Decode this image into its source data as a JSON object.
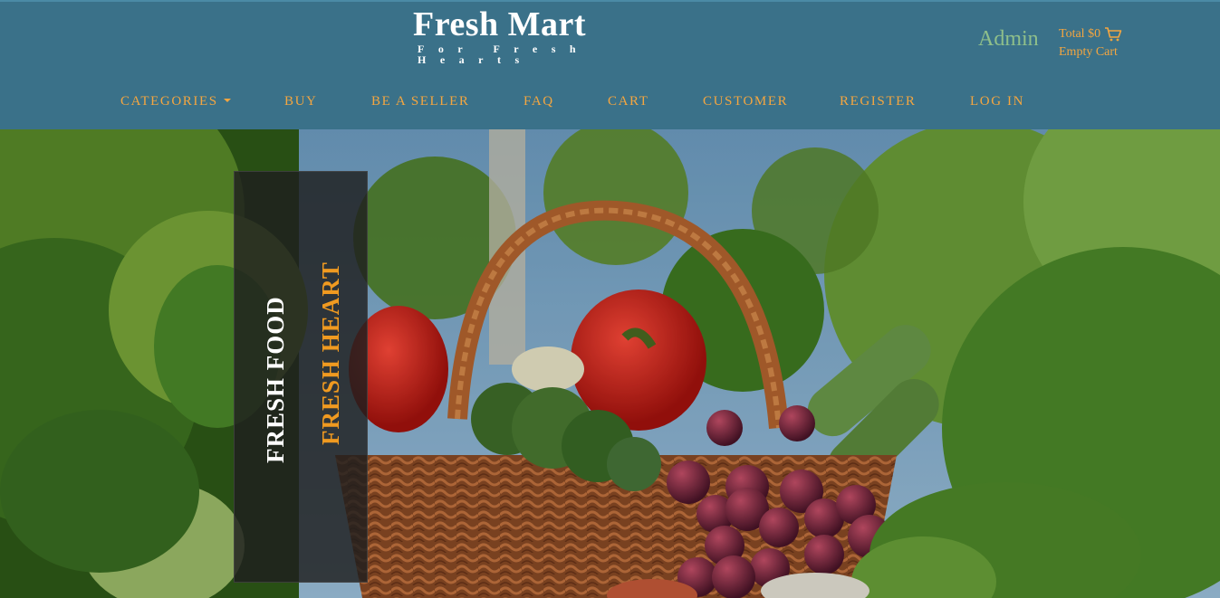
{
  "brand": {
    "title": "Fresh Mart",
    "tagline": "For Fresh Hearts"
  },
  "account": {
    "admin_label": "Admin"
  },
  "cart": {
    "total_label": "Total $0",
    "status": "Empty Cart",
    "icon": "shopping-cart-icon"
  },
  "nav": {
    "items": [
      {
        "label": "CATEGORIES",
        "has_dropdown": true
      },
      {
        "label": "BUY"
      },
      {
        "label": "BE A SELLER"
      },
      {
        "label": "FAQ"
      },
      {
        "label": "CART"
      },
      {
        "label": "CUSTOMER"
      },
      {
        "label": "REGISTER"
      },
      {
        "label": "LOG IN"
      }
    ]
  },
  "hero": {
    "line1": "FRESH FOOD",
    "line2": "FRESH HEART"
  },
  "colors": {
    "header_bg": "#3a7189",
    "nav_text": "#f4a640",
    "admin_text": "#8fbf8a",
    "banner_accent": "#f09a20"
  }
}
